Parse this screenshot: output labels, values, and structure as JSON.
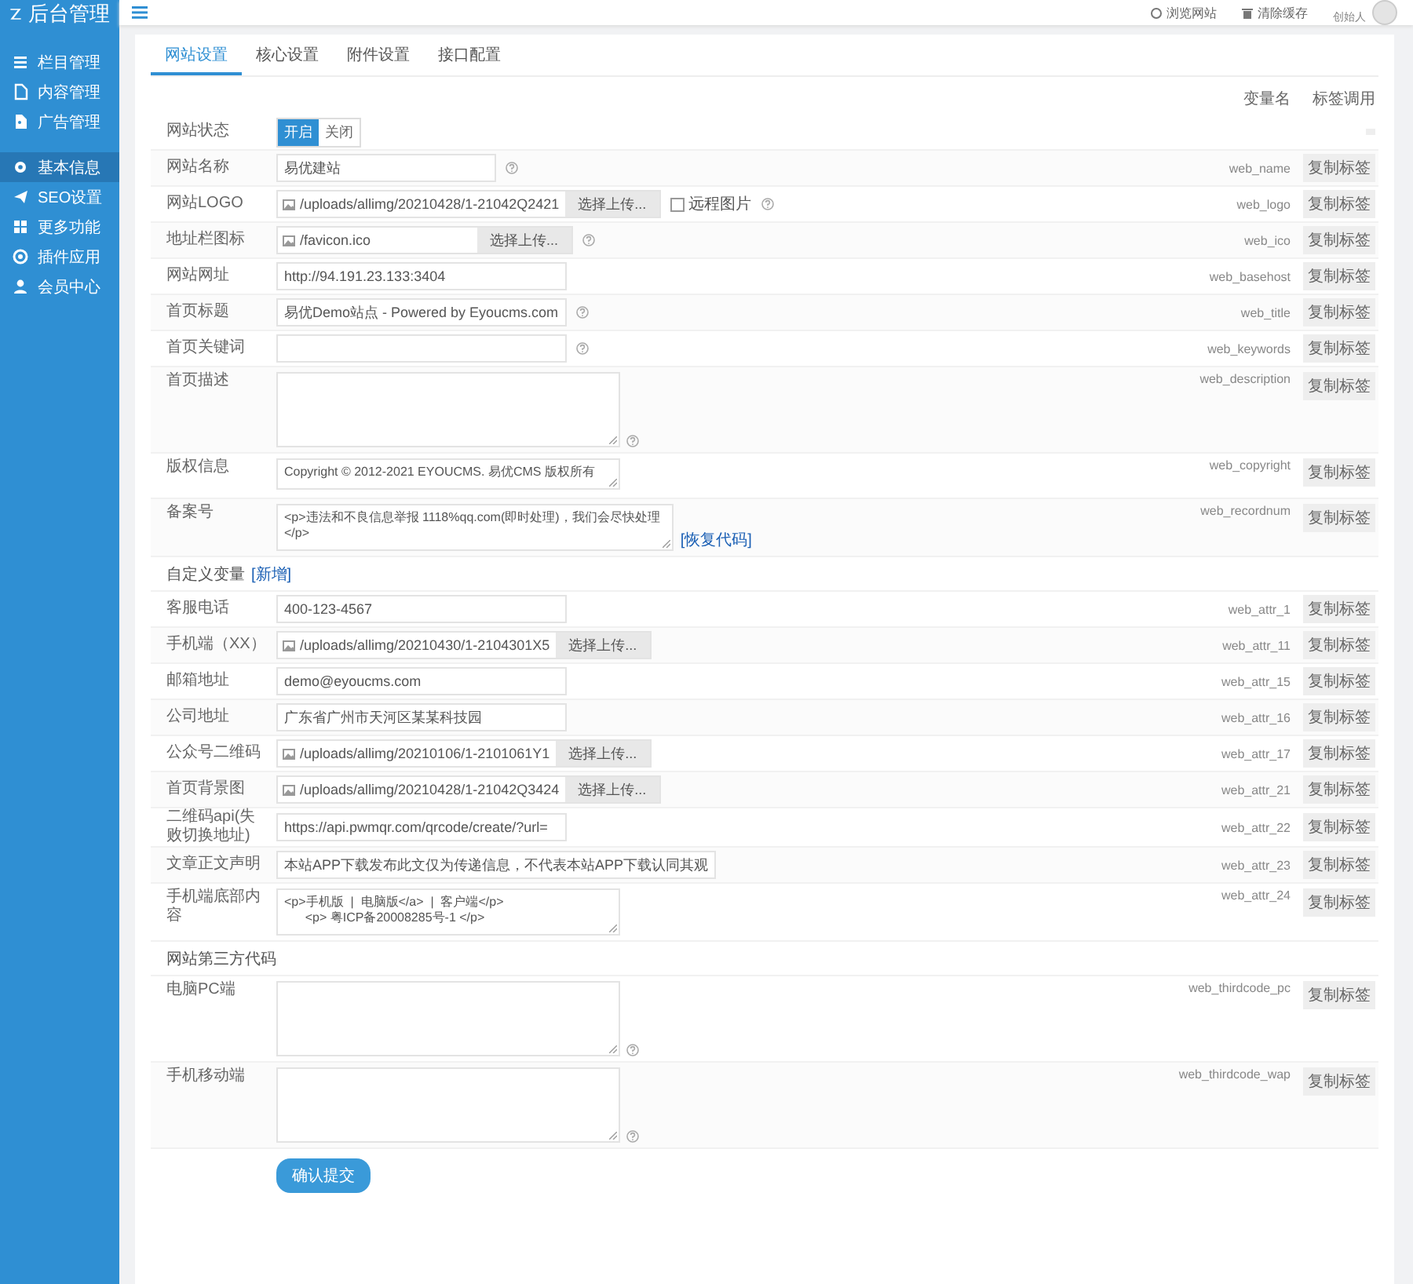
{
  "topbar": {
    "links": [
      "浏览网站",
      "清除缓存"
    ],
    "user_role": "创始人"
  },
  "sidebar": {
    "logo": "后台管理",
    "groups": [
      [
        {
          "label": "栏目管理",
          "selected": false
        },
        {
          "label": "内容管理",
          "selected": false
        },
        {
          "label": "广告管理",
          "selected": false
        }
      ],
      [
        {
          "label": "基本信息",
          "selected": true
        },
        {
          "label": "SEO设置",
          "selected": false
        },
        {
          "label": "更多功能",
          "selected": false
        },
        {
          "label": "插件应用",
          "selected": false
        },
        {
          "label": "会员中心",
          "selected": false
        }
      ]
    ]
  },
  "tabs": [
    {
      "label": "网站设置",
      "selected": true
    },
    {
      "label": "核心设置",
      "selected": false
    },
    {
      "label": "附件设置",
      "selected": false
    },
    {
      "label": "接口配置",
      "selected": false
    }
  ],
  "columns": {
    "var": "变量名",
    "call": "标签调用"
  },
  "rows": [
    {
      "kind": "switch",
      "label": "网站状态",
      "options": [
        {
          "label": "开启",
          "selected": true
        },
        {
          "label": "关闭",
          "selected": false
        }
      ]
    },
    {
      "kind": "text",
      "label": "网站名称",
      "value": "易优建站",
      "help": true,
      "var": "web_name",
      "copy": "复制标签"
    },
    {
      "kind": "upload",
      "label": "网站LOGO",
      "value": "/uploads/allimg/20210428/1-21042Q2421",
      "button": "选择上传...",
      "remote": {
        "label": "远程图片",
        "checked": false
      },
      "help": true,
      "var": "web_logo",
      "copy": "复制标签"
    },
    {
      "kind": "upload",
      "label": "地址栏图标",
      "value": "/favicon.ico",
      "button": "选择上传...",
      "help": true,
      "var": "web_ico",
      "copy": "复制标签"
    },
    {
      "kind": "text",
      "label": "网站网址",
      "value": "http://94.191.23.133:3404",
      "help": false,
      "var": "web_basehost",
      "copy": "复制标签"
    },
    {
      "kind": "text",
      "label": "首页标题",
      "value": "易优Demo站点 - Powered by Eyoucms.com",
      "help": true,
      "var": "web_title",
      "copy": "复制标签"
    },
    {
      "kind": "text",
      "label": "首页关键词",
      "value": "",
      "help": true,
      "var": "web_keywords",
      "copy": "复制标签"
    },
    {
      "kind": "textarea",
      "label": "首页描述",
      "value": "",
      "help": true,
      "var": "web_description",
      "copy": "复制标签"
    },
    {
      "kind": "textarea",
      "label": "版权信息",
      "value": "Copyright © 2012-2021 EYOUCMS. 易优CMS 版权所有",
      "help": false,
      "var": "web_copyright",
      "copy": "复制标签"
    },
    {
      "kind": "textarea",
      "label": "备案号",
      "value": "<p>违法和不良信息举报 1118%qq.com(即时处理)，我们会尽快处理\n</p>",
      "help": false,
      "link": "[恢复代码]",
      "var": "web_recordnum",
      "copy": "复制标签"
    },
    {
      "kind": "section",
      "label": "自定义变量",
      "link": "[新增]"
    },
    {
      "kind": "text",
      "label": "客服电话",
      "value": "400-123-4567",
      "help": false,
      "var": "web_attr_1",
      "copy": "复制标签"
    },
    {
      "kind": "upload",
      "label": "手机端（XX）",
      "value": "/uploads/allimg/20210430/1-2104301X5",
      "button": "选择上传...",
      "help": false,
      "var": "web_attr_11",
      "copy": "复制标签"
    },
    {
      "kind": "text",
      "label": "邮箱地址",
      "value": "demo@eyoucms.com",
      "help": false,
      "var": "web_attr_15",
      "copy": "复制标签"
    },
    {
      "kind": "text",
      "label": "公司地址",
      "value": "广东省广州市天河区某某科技园",
      "help": false,
      "var": "web_attr_16",
      "copy": "复制标签"
    },
    {
      "kind": "upload",
      "label": "公众号二维码",
      "value": "/uploads/allimg/20210106/1-2101061Y1",
      "button": "选择上传...",
      "help": false,
      "var": "web_attr_17",
      "copy": "复制标签"
    },
    {
      "kind": "upload",
      "label": "首页背景图",
      "value": "/uploads/allimg/20210428/1-21042Q3424",
      "button": "选择上传...",
      "help": false,
      "var": "web_attr_21",
      "copy": "复制标签"
    },
    {
      "kind": "text",
      "label": "二维码api(失败切换地址)",
      "value": "https://api.pwmqr.com/qrcode/create/?url=",
      "help": false,
      "var": "web_attr_22",
      "copy": "复制标签"
    },
    {
      "kind": "text",
      "label": "文章正文声明",
      "value": "本站APP下载发布此文仅为传递信息，不代表本站APP下载认同其观",
      "help": false,
      "var": "web_attr_23",
      "copy": "复制标签"
    },
    {
      "kind": "textarea",
      "label": "手机端底部内容",
      "value": "<p>手机版  |  电脑版</a>  |  客户端</p>\n      <p> 粤ICP备20008285号-1 </p>",
      "help": false,
      "var": "web_attr_24",
      "copy": "复制标签"
    },
    {
      "kind": "section",
      "label": "网站第三方代码"
    },
    {
      "kind": "textarea",
      "label": "电脑PC端",
      "value": "",
      "help": true,
      "var": "web_thirdcode_pc",
      "copy": "复制标签"
    },
    {
      "kind": "textarea",
      "label": "手机移动端",
      "value": "",
      "help": true,
      "var": "web_thirdcode_wap",
      "copy": "复制标签"
    }
  ],
  "submit": "确认提交"
}
